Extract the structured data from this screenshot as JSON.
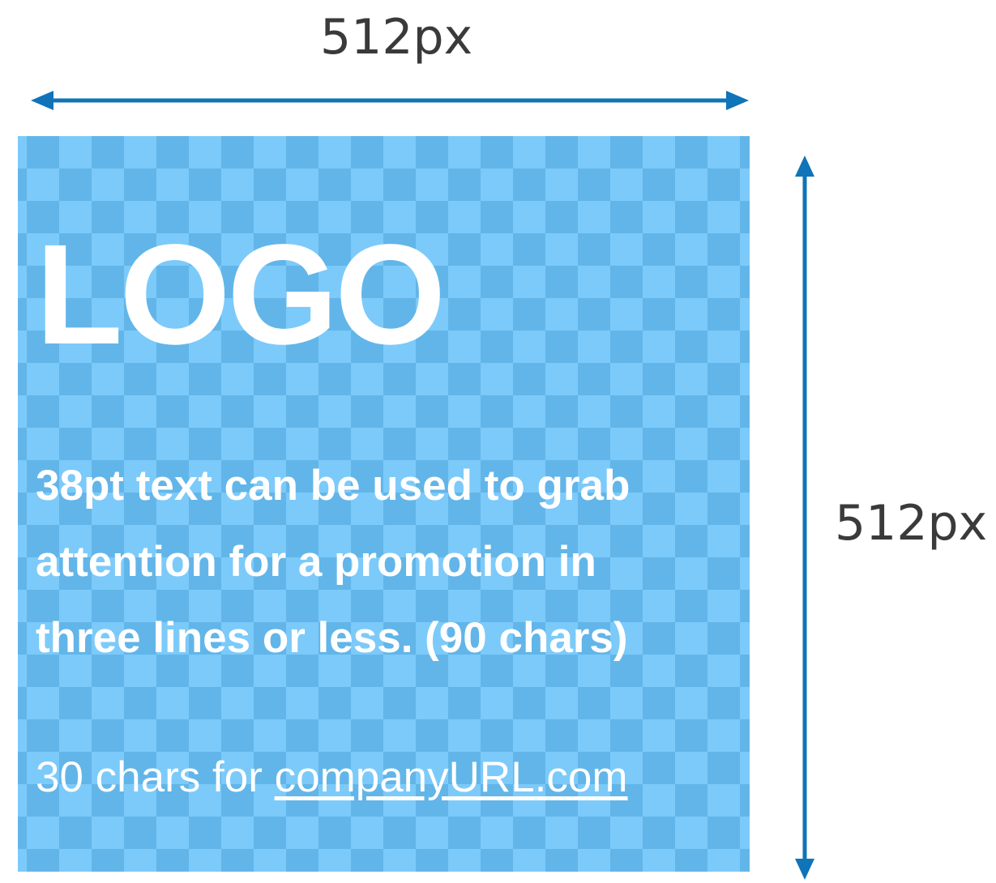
{
  "dimensions": {
    "width_label": "512px",
    "height_label": "512px",
    "arrow_color": "#0f74b8"
  },
  "banner": {
    "background_color": "#62b5e8",
    "checker_color": "#7ccafa",
    "logo_text": "LOGO",
    "promo_lines": [
      "38pt text can be used to grab",
      "attention for a promotion in",
      "three lines or less. (90 chars)"
    ],
    "url_prefix": "30 chars for ",
    "url_link": "companyURL.com"
  }
}
